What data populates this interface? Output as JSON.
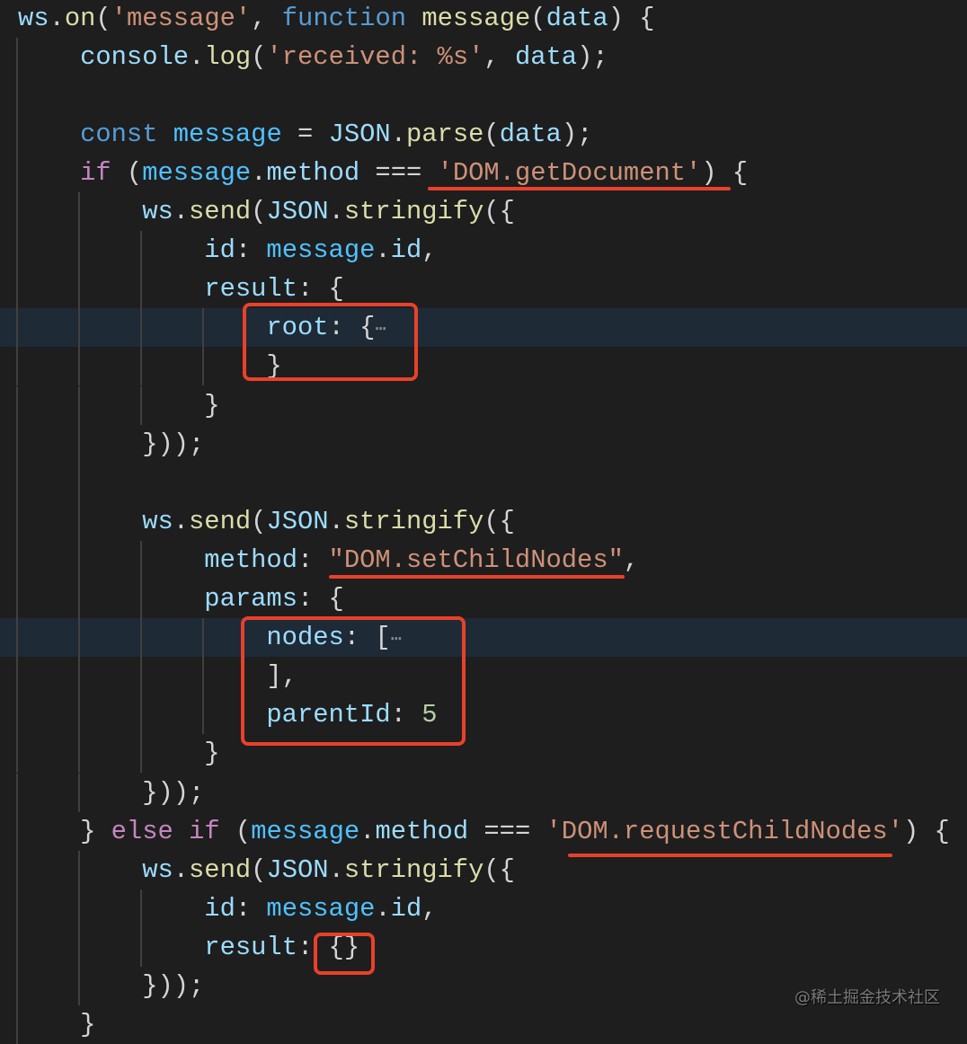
{
  "editor": {
    "theme": {
      "background": "#1e1e1e",
      "highlight_line": "#1f2a37",
      "annotation": "#e8412b"
    },
    "lines": [
      {
        "indent": 0,
        "tokens": [
          [
            "var",
            "ws"
          ],
          [
            "p",
            "."
          ],
          [
            "fn",
            "on"
          ],
          [
            "p",
            "("
          ],
          [
            "str",
            "'message'"
          ],
          [
            "p",
            ", "
          ],
          [
            "kw",
            "function"
          ],
          [
            "p",
            " "
          ],
          [
            "fn",
            "message"
          ],
          [
            "p",
            "("
          ],
          [
            "var",
            "data"
          ],
          [
            "p",
            ") {"
          ]
        ]
      },
      {
        "indent": 1,
        "tokens": [
          [
            "var",
            "console"
          ],
          [
            "p",
            "."
          ],
          [
            "fn",
            "log"
          ],
          [
            "p",
            "("
          ],
          [
            "str",
            "'received: %s'"
          ],
          [
            "p",
            ", "
          ],
          [
            "var",
            "data"
          ],
          [
            "p",
            ");"
          ]
        ]
      },
      {
        "indent": 1,
        "tokens": []
      },
      {
        "indent": 1,
        "tokens": [
          [
            "kw",
            "const"
          ],
          [
            "p",
            " "
          ],
          [
            "const",
            "message"
          ],
          [
            "p",
            " = "
          ],
          [
            "cls",
            "JSON"
          ],
          [
            "p",
            "."
          ],
          [
            "fn",
            "parse"
          ],
          [
            "p",
            "("
          ],
          [
            "var",
            "data"
          ],
          [
            "p",
            ");"
          ]
        ]
      },
      {
        "indent": 1,
        "tokens": [
          [
            "ctl",
            "if"
          ],
          [
            "p",
            " ("
          ],
          [
            "const",
            "message"
          ],
          [
            "p",
            "."
          ],
          [
            "var",
            "method"
          ],
          [
            "p",
            " === "
          ],
          [
            "str",
            "'DOM.getDocument'"
          ],
          [
            "p",
            ") {"
          ]
        ]
      },
      {
        "indent": 2,
        "tokens": [
          [
            "var",
            "ws"
          ],
          [
            "p",
            "."
          ],
          [
            "fn",
            "send"
          ],
          [
            "p",
            "("
          ],
          [
            "cls",
            "JSON"
          ],
          [
            "p",
            "."
          ],
          [
            "fn",
            "stringify"
          ],
          [
            "p",
            "({"
          ]
        ]
      },
      {
        "indent": 3,
        "tokens": [
          [
            "var",
            "id"
          ],
          [
            "p",
            ": "
          ],
          [
            "const",
            "message"
          ],
          [
            "p",
            "."
          ],
          [
            "var",
            "id"
          ],
          [
            "p",
            ","
          ]
        ]
      },
      {
        "indent": 3,
        "tokens": [
          [
            "var",
            "result"
          ],
          [
            "p",
            ": {"
          ]
        ]
      },
      {
        "indent": 4,
        "highlight": true,
        "tokens": [
          [
            "var",
            "root"
          ],
          [
            "p",
            ": {"
          ],
          [
            "fold",
            "⋯"
          ]
        ]
      },
      {
        "indent": 4,
        "tokens": [
          [
            "p",
            "}"
          ]
        ]
      },
      {
        "indent": 3,
        "tokens": [
          [
            "p",
            "}"
          ]
        ]
      },
      {
        "indent": 2,
        "tokens": [
          [
            "p",
            "}));"
          ]
        ]
      },
      {
        "indent": 2,
        "tokens": []
      },
      {
        "indent": 2,
        "tokens": [
          [
            "var",
            "ws"
          ],
          [
            "p",
            "."
          ],
          [
            "fn",
            "send"
          ],
          [
            "p",
            "("
          ],
          [
            "cls",
            "JSON"
          ],
          [
            "p",
            "."
          ],
          [
            "fn",
            "stringify"
          ],
          [
            "p",
            "({"
          ]
        ]
      },
      {
        "indent": 3,
        "tokens": [
          [
            "var",
            "method"
          ],
          [
            "p",
            ": "
          ],
          [
            "str",
            "\"DOM.setChildNodes\""
          ],
          [
            "p",
            ","
          ]
        ]
      },
      {
        "indent": 3,
        "tokens": [
          [
            "var",
            "params"
          ],
          [
            "p",
            ": {"
          ]
        ]
      },
      {
        "indent": 4,
        "highlight": true,
        "tokens": [
          [
            "var",
            "nodes"
          ],
          [
            "p",
            ": ["
          ],
          [
            "fold",
            "⋯"
          ]
        ]
      },
      {
        "indent": 4,
        "tokens": [
          [
            "p",
            "],"
          ]
        ]
      },
      {
        "indent": 4,
        "tokens": [
          [
            "var",
            "parentId"
          ],
          [
            "p",
            ": "
          ],
          [
            "num",
            "5"
          ]
        ]
      },
      {
        "indent": 3,
        "tokens": [
          [
            "p",
            "}"
          ]
        ]
      },
      {
        "indent": 2,
        "tokens": [
          [
            "p",
            "}));"
          ]
        ]
      },
      {
        "indent": 1,
        "tokens": [
          [
            "p",
            "} "
          ],
          [
            "ctl",
            "else"
          ],
          [
            "p",
            " "
          ],
          [
            "ctl",
            "if"
          ],
          [
            "p",
            " ("
          ],
          [
            "const",
            "message"
          ],
          [
            "p",
            "."
          ],
          [
            "var",
            "method"
          ],
          [
            "p",
            " === "
          ],
          [
            "str",
            "'DOM.requestChildNodes'"
          ],
          [
            "p",
            ") {"
          ]
        ]
      },
      {
        "indent": 2,
        "tokens": [
          [
            "var",
            "ws"
          ],
          [
            "p",
            "."
          ],
          [
            "fn",
            "send"
          ],
          [
            "p",
            "("
          ],
          [
            "cls",
            "JSON"
          ],
          [
            "p",
            "."
          ],
          [
            "fn",
            "stringify"
          ],
          [
            "p",
            "({"
          ]
        ]
      },
      {
        "indent": 3,
        "tokens": [
          [
            "var",
            "id"
          ],
          [
            "p",
            ": "
          ],
          [
            "const",
            "message"
          ],
          [
            "p",
            "."
          ],
          [
            "var",
            "id"
          ],
          [
            "p",
            ","
          ]
        ]
      },
      {
        "indent": 3,
        "tokens": [
          [
            "var",
            "result"
          ],
          [
            "p",
            ": {}"
          ]
        ]
      },
      {
        "indent": 2,
        "tokens": [
          [
            "p",
            "}));"
          ]
        ]
      },
      {
        "indent": 1,
        "tokens": [
          [
            "p",
            "}"
          ]
        ]
      }
    ]
  },
  "watermark": "@稀土掘金技术社区"
}
